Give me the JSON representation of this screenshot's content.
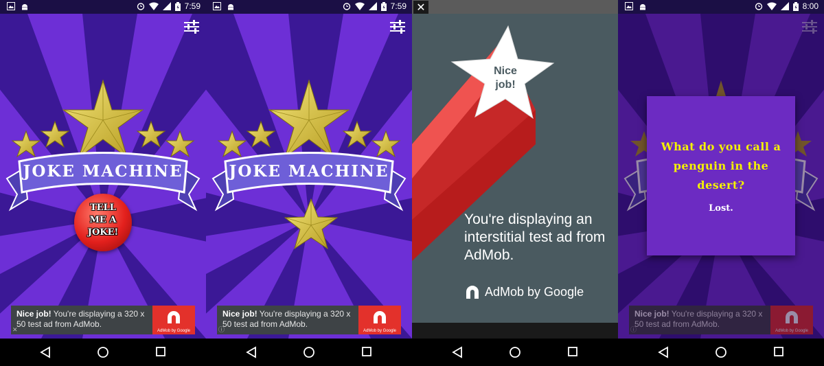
{
  "colors": {
    "bg_light": "#7a37e0",
    "bg_dark": "#3a1793",
    "ribbon": "#6e5fd8",
    "star_gold": "#e8d34a",
    "button_red": "#e3201d",
    "ad_red": "#e3312b",
    "interstitial_bg": "#4a5a60"
  },
  "screens": [
    {
      "status": {
        "time": "7:59"
      },
      "logo_text": "JOKE MACHINE",
      "joke_button": {
        "line1": "TELL",
        "line2": "ME A",
        "line3": "JOKE!"
      },
      "ad": {
        "bold": "Nice job!",
        "text": " You're displaying a 320 x 50 test ad from AdMob.",
        "logo_caption": "AdMob by Google",
        "corner_icon": "close-icon",
        "corner": "✕"
      }
    },
    {
      "status": {
        "time": "7:59"
      },
      "logo_text": "JOKE MACHINE",
      "ad": {
        "bold": "Nice job!",
        "text": " You're displaying a 320 x 50 test ad from AdMob.",
        "logo_caption": "AdMob by Google",
        "corner_icon": "info-icon",
        "corner": "ⓘ"
      }
    },
    {
      "close_label": "✕",
      "star_text": {
        "line1": "Nice",
        "line2": "job!"
      },
      "message": "You're displaying an interstitial test ad from AdMob.",
      "brand": "AdMob by Google"
    },
    {
      "status": {
        "time": "8:00"
      },
      "question": "What do you call a penguin in the desert?",
      "answer": "Lost.",
      "ad": {
        "bold": "Nice job!",
        "text": " You're displaying a 320 x 50 test ad from AdMob.",
        "logo_caption": "AdMob by Google",
        "corner_icon": "info-icon",
        "corner": "ⓘ"
      }
    }
  ]
}
